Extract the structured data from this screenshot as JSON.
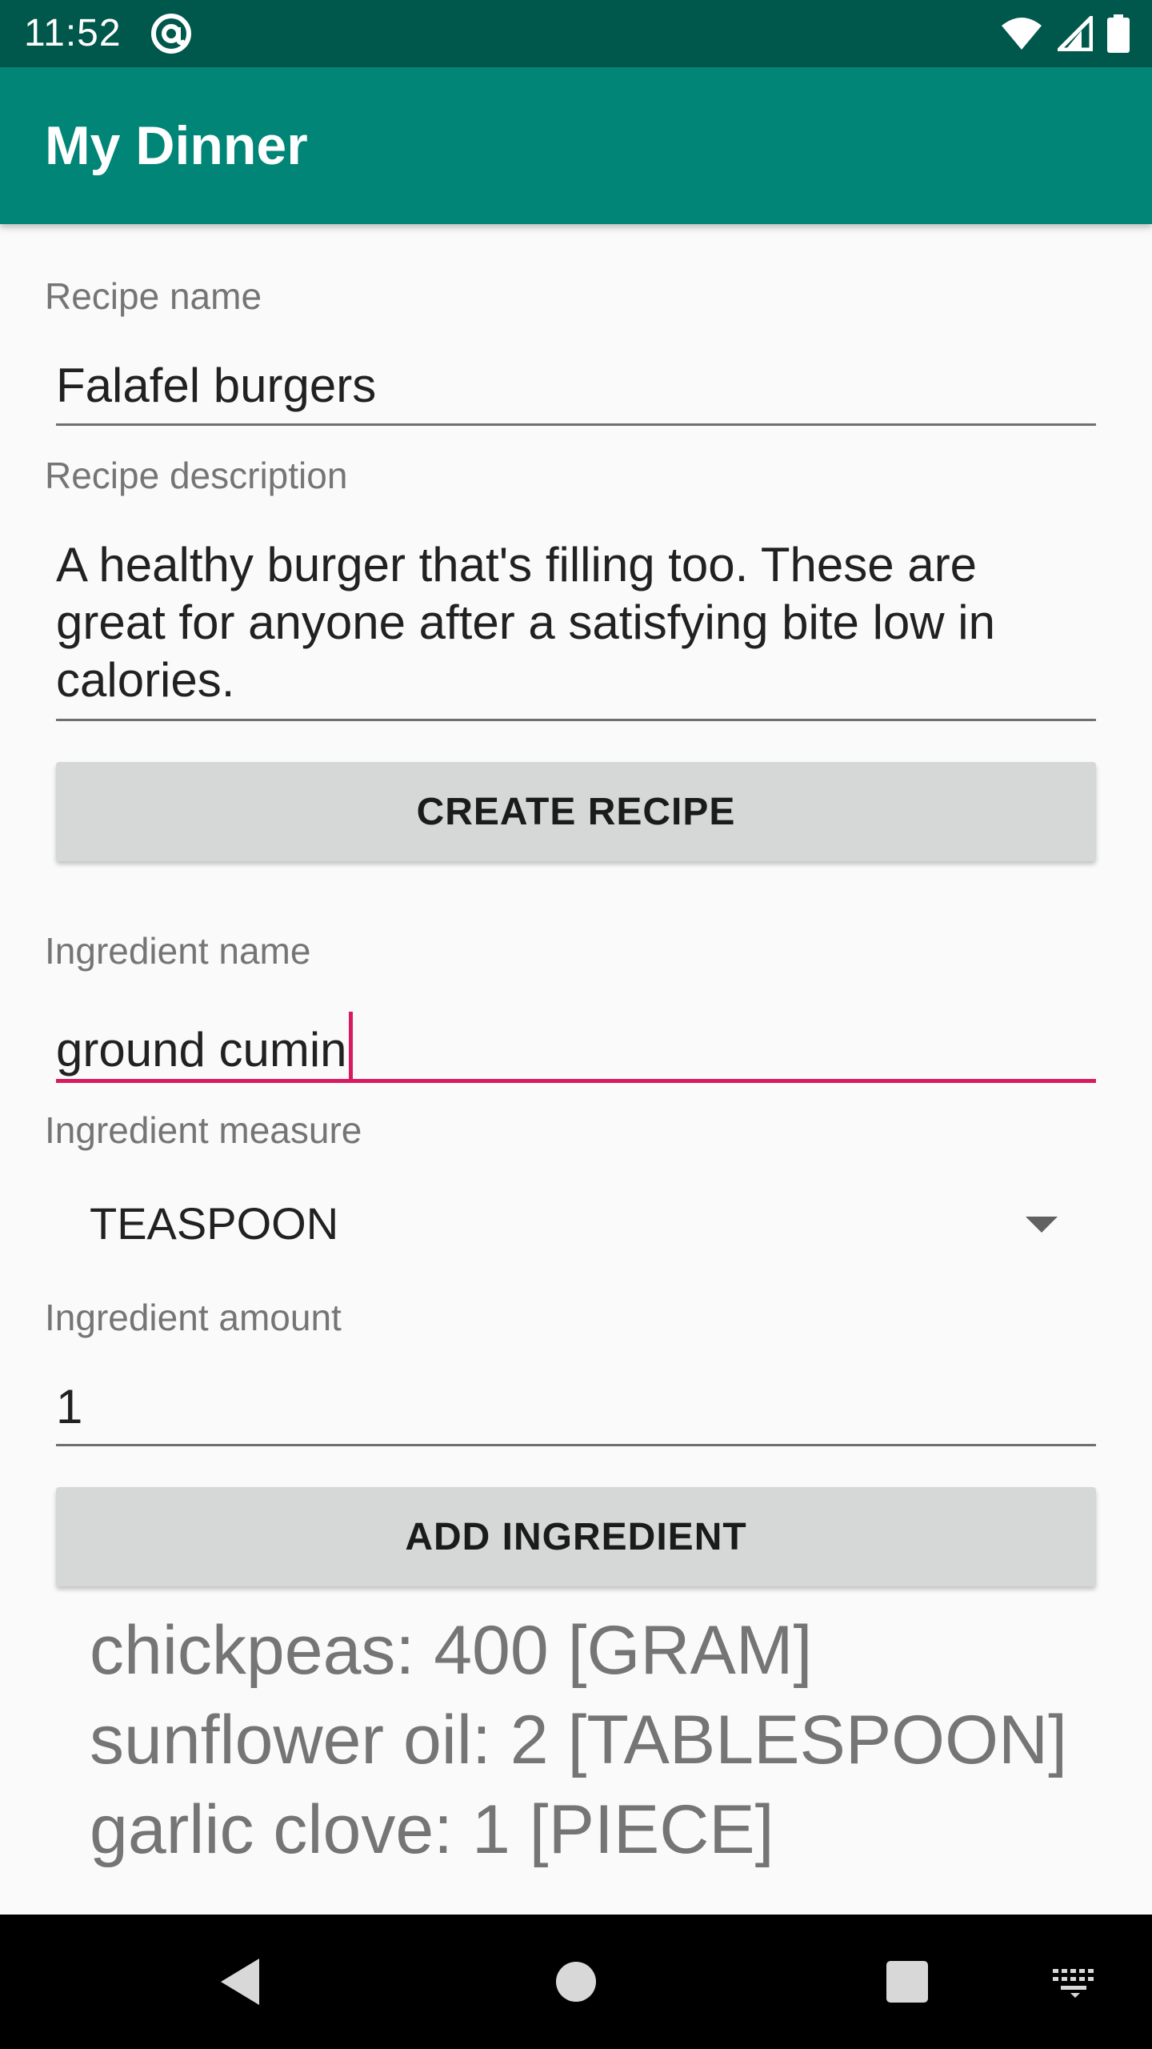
{
  "status_bar": {
    "time": "11:52",
    "icons": [
      "at-sign-icon",
      "wifi-icon",
      "cellular-signal-icon",
      "battery-icon"
    ]
  },
  "app_bar": {
    "title": "My Dinner",
    "color": "#008577"
  },
  "recipe": {
    "name_label": "Recipe name",
    "name_value": "Falafel burgers",
    "description_label": "Recipe description",
    "description_value": "A healthy burger that's filling too. These are great for anyone after a satisfying bite low in calories.",
    "create_button": "CREATE RECIPE"
  },
  "ingredient": {
    "name_label": "Ingredient name",
    "name_value": "ground cumin",
    "measure_label": "Ingredient measure",
    "measure_value": "TEASPOON",
    "amount_label": "Ingredient amount",
    "amount_value": "1",
    "add_button": "ADD INGREDIENT",
    "focus_color": "#d81b60"
  },
  "ingredients_list": [
    "chickpeas: 400 [GRAM]",
    "sunflower oil: 2 [TABLESPOON]",
    "garlic clove: 1 [PIECE]"
  ],
  "nav_bar": {
    "icons": [
      "back-icon",
      "home-icon",
      "recents-icon",
      "keyboard-icon"
    ]
  }
}
